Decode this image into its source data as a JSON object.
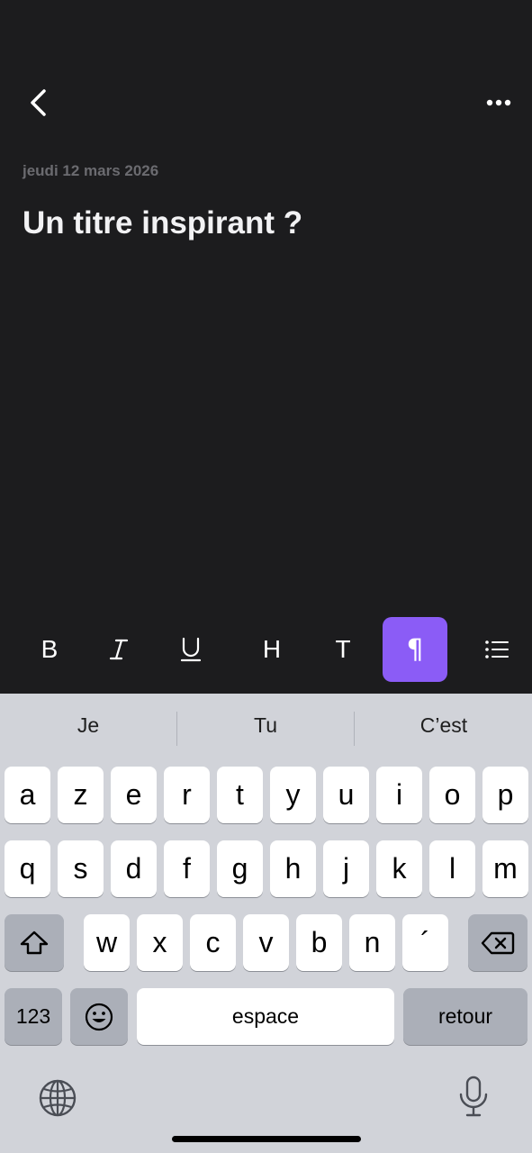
{
  "header": {
    "back_icon": "chevron-left-icon",
    "more_icon": "ellipsis-icon"
  },
  "note": {
    "date": "jeudi 12 mars 2026",
    "title_placeholder": "Un titre inspirant ?"
  },
  "toolbar": {
    "accent_color": "#8b5cf6",
    "bold_label": "B",
    "heading_label": "H",
    "text_label": "T",
    "paragraph_label": "¶"
  },
  "keyboard": {
    "suggestions": [
      "Je",
      "Tu",
      "C’est"
    ],
    "row1": [
      "a",
      "z",
      "e",
      "r",
      "t",
      "y",
      "u",
      "i",
      "o",
      "p"
    ],
    "row2": [
      "q",
      "s",
      "d",
      "f",
      "g",
      "h",
      "j",
      "k",
      "l",
      "m"
    ],
    "row3": [
      "w",
      "x",
      "c",
      "v",
      "b",
      "n",
      "´"
    ],
    "numbers_label": "123",
    "space_label": "espace",
    "return_label": "retour"
  }
}
